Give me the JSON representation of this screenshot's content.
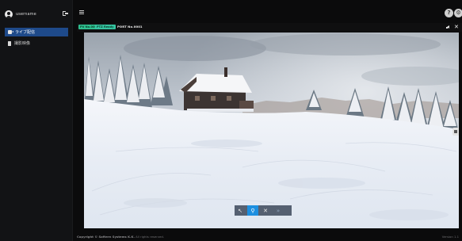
{
  "user": {
    "name": "username"
  },
  "nav": {
    "items": [
      {
        "label": "ライブ配信",
        "icon": "video-camera-icon",
        "active": true
      },
      {
        "label": "撮影映像",
        "icon": "document-icon",
        "active": false
      }
    ]
  },
  "header": {
    "help_icon": "help-icon",
    "settings_icon": "settings-icon"
  },
  "viewer": {
    "badge_1": "PV No.0000",
    "badge_2": "PTZ Ready",
    "frame_label": "PORT No.0001",
    "toolbar": {
      "tools": [
        {
          "icon": "pointer-icon",
          "glyph": "↖",
          "active": false
        },
        {
          "icon": "location-pin-icon",
          "glyph": "⚲",
          "active": true
        },
        {
          "icon": "close-icon",
          "glyph": "✕",
          "active": false
        },
        {
          "icon": "expand-icon",
          "glyph": "»",
          "active": false
        }
      ]
    }
  },
  "footer": {
    "company": "Copyright © Softern Systems K.K.",
    "rights": " All rights reserved.",
    "version": "Version 1.1"
  },
  "colors": {
    "accent": "#1e4a8a",
    "badge": "#2fbf8f",
    "tool_active": "#1c8fe0"
  }
}
